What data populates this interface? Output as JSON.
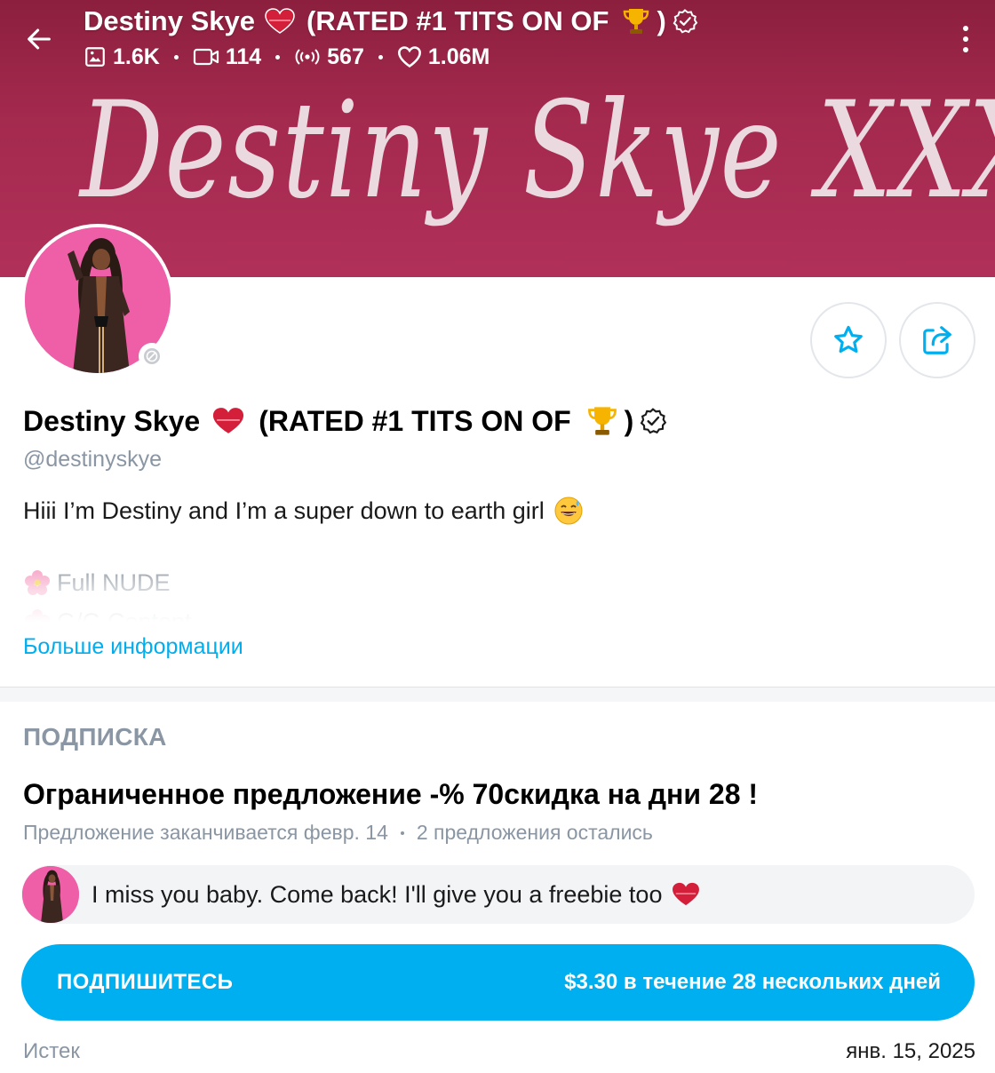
{
  "header": {
    "back_icon": "arrow-left-icon",
    "title_name": "Destiny Skye",
    "title_suffix": "(RATED #1 TITS ON OF",
    "title_close": ")",
    "menu_icon": "more-vertical-icon",
    "stats": {
      "photos": "1.6K",
      "videos": "114",
      "streams": "567",
      "likes": "1.06M"
    }
  },
  "banner": {
    "script_text": "Destiny Skye XXX",
    "color": "#a52a4f"
  },
  "profile": {
    "name": "Destiny Skye",
    "name_suffix": "(RATED #1 TITS ON OF",
    "name_close": ")",
    "handle": "@destinyskye",
    "bio_line1": "Hiii I’m Destiny and I’m a super down to earth girl",
    "bio_line2": "Full NUDE",
    "bio_line3": "G/G Content",
    "more_info": "Больше информации",
    "favorite_icon": "star-icon",
    "share_icon": "share-icon"
  },
  "subscription": {
    "section_title": "ПОДПИСКА",
    "promo_title": "Ограниченное предложение -% 70скидка на дни 28 !",
    "promo_ends": "Предложение заканчивается февр. 14",
    "promo_left": "2 предложения остались",
    "message": "I miss you baby. Come back! I'll give you a freebie too",
    "button_label": "ПОДПИШИТЕСЬ",
    "button_price": "$3.30 в течение 28 нескольких дней",
    "expire_label": "Истек",
    "expire_date": "янв. 15, 2025",
    "accent": "#00aff0"
  }
}
